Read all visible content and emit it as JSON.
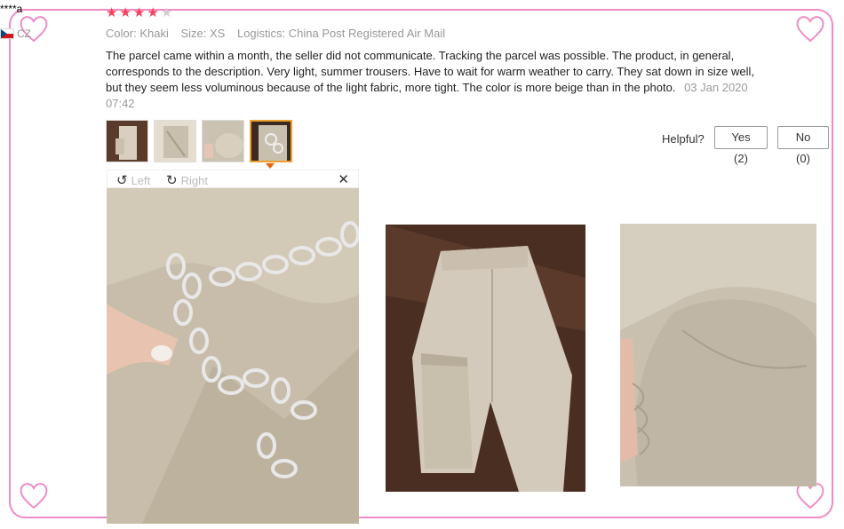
{
  "reviewer": {
    "name": "****a",
    "country": "CZ"
  },
  "rating": {
    "filled": 4,
    "total": 5
  },
  "meta": {
    "color_key": "Color:",
    "color_val": "Khaki",
    "size_key": "Size:",
    "size_val": "XS",
    "logistics_key": "Logistics:",
    "logistics_val": "China Post Registered Air Mail"
  },
  "review": {
    "text": "The parcel came within a month, the seller did not communicate. Tracking the parcel was possible. The product, in general, corresponds to the description. Very light, summer trousers. Have to wait for warm weather to carry. They sat down in size well, but they seem less voluminous because of the light fabric, more tight. The color is more beige than in the photo.",
    "date": "03 Jan 2020 07:42"
  },
  "thumbnails": {
    "count": 4,
    "active_index": 3
  },
  "helpful": {
    "label": "Helpful?",
    "yes": "Yes (2)",
    "no": "No (0)"
  },
  "viewer": {
    "rotate_left": "Left",
    "rotate_right": "Right",
    "close_icon": "close-icon"
  },
  "colors": {
    "frame": "#f08bc6",
    "star": "#f5405e",
    "active_thumb": "#f0a030"
  }
}
